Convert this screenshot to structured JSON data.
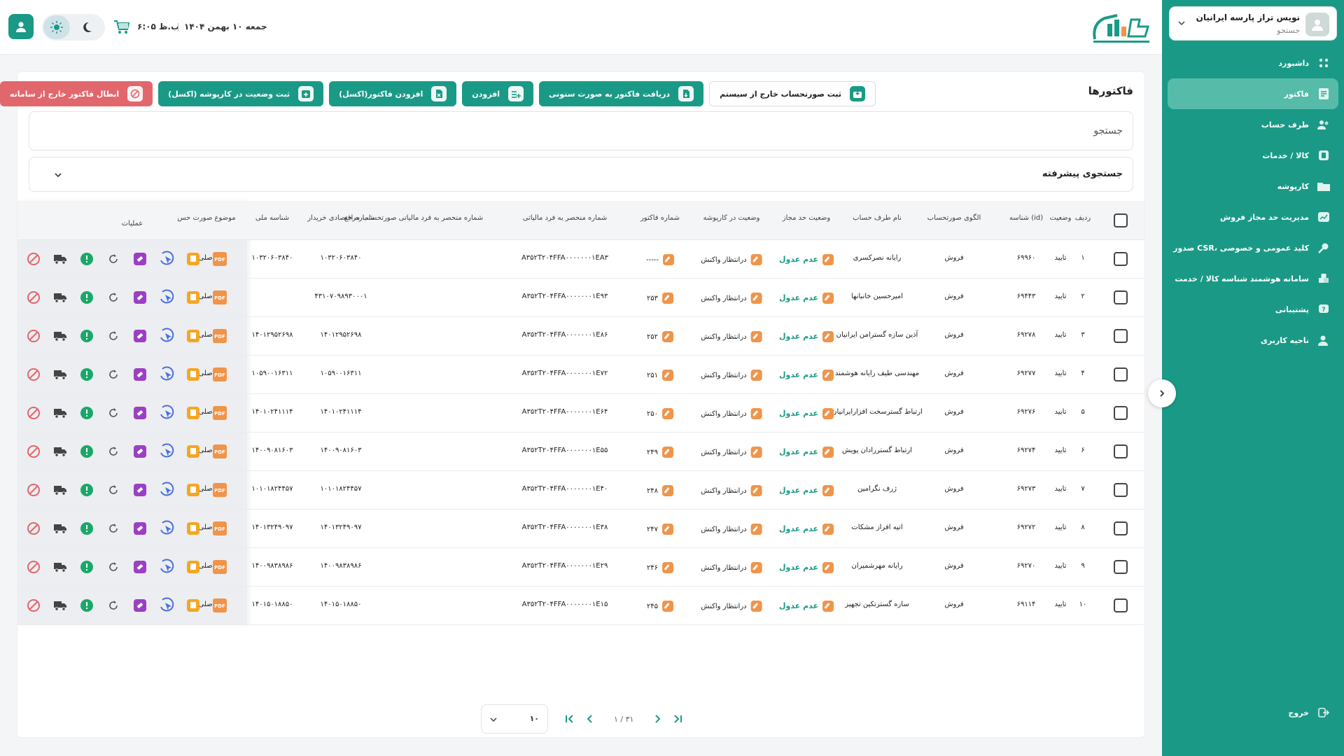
{
  "sidebar": {
    "user_name": "نویس تراز پارسه ایرانیان",
    "user_sub": "جستجو",
    "items": [
      {
        "label": "داشبورد",
        "icon": "dashboard-icon",
        "active": false
      },
      {
        "label": "فاکتور",
        "icon": "invoice-icon",
        "active": true
      },
      {
        "label": "طرف حساب",
        "icon": "users-icon",
        "active": false
      },
      {
        "label": "کالا / خدمات",
        "icon": "product-icon",
        "active": false
      },
      {
        "label": "کارپوشه",
        "icon": "folder-icon",
        "active": false
      },
      {
        "label": "مدیریت حد مجاز فروش",
        "icon": "chart-icon",
        "active": false
      },
      {
        "label": "صدور CSR، کلید عمومی و خصوصی",
        "icon": "key-icon",
        "active": false
      },
      {
        "label": "سامانه هوشمند شناسه کالا / خدمت",
        "icon": "boxes-icon",
        "active": false
      },
      {
        "label": "پشتیبانی",
        "icon": "support-icon",
        "active": false
      },
      {
        "label": "ناحیه کاربری",
        "icon": "user-area-icon",
        "active": false
      }
    ],
    "logout": "خروج"
  },
  "topbar": {
    "time": "۶:۰۵ ب.ظ",
    "date": "جمعه ۱۰ بهمن ۱۴۰۴"
  },
  "page": {
    "title": "فاکتورها",
    "actions": [
      {
        "label": "ثبت صورتحساب خارج از سیستم",
        "style": "outline",
        "icon": "import-icon"
      },
      {
        "label": "دریافت فاکتور به صورت ستونی",
        "style": "teal",
        "icon": "download-file-icon"
      },
      {
        "label": "افزودن",
        "style": "teal",
        "icon": "add-list-icon"
      },
      {
        "label": "افزودن فاکتور(اکسل)",
        "style": "teal",
        "icon": "excel-upload-icon"
      },
      {
        "label": "ثبت وضعیت در کارپوشه (اکسل)",
        "style": "teal",
        "icon": "calendar-plus-icon"
      },
      {
        "label": "ابطال فاکتور خارج از سامانه",
        "style": "red",
        "icon": "cancel-icon"
      }
    ],
    "search_placeholder": "جستجو",
    "advanced_search": "جستجوی پیشرفته"
  },
  "table": {
    "headers": {
      "row": "ردیف",
      "status": "وضعیت",
      "id": "شناسه (id)",
      "pattern": "الگوی صورتحساب",
      "party": "نام طرف حساب",
      "limit": "وضعیت حد مجاز",
      "folder": "وضعیت در کارپوشه",
      "number": "شماره فاکتور",
      "taxid": "شماره منحصر به فرد مالیاتی",
      "ref": "شماره منحصر به فرد مالیاتی صورتحساب مرجع",
      "econ": "شماره اقتصادی خریدار",
      "national": "شناسه ملی",
      "subject": "موضوع صورت حس",
      "ops": "عملیات"
    },
    "rows": [
      {
        "row": "۱",
        "status": "تایید",
        "id": "۶۹۹۶۰",
        "pattern": "فروش",
        "party": "رایانه نصرکسری",
        "limit": "عدم عدول",
        "folder": "درانتظار واکنش",
        "number": "-----",
        "taxid": "A۳۵۲T۲۰۴FFA۰۰۰۰۰۰۰۱EA۳",
        "ref": "",
        "econ": "۱۰۳۲۰۶۰۳۸۴۰",
        "national": "۱۰۳۲۰۶۰۳۸۴۰",
        "subject": "اصلی"
      },
      {
        "row": "۲",
        "status": "تایید",
        "id": "۶۹۴۴۳",
        "pattern": "فروش",
        "party": "امیرحسین خانبانها",
        "limit": "عدم عدول",
        "folder": "درانتظار واکنش",
        "number": "۲۵۳",
        "taxid": "A۳۵۲T۲۰۴FFA۰۰۰۰۰۰۰۱E۹۳",
        "ref": "",
        "econ": "۴۳۱۰۷۰۹۸۹۳۰۰۰۱",
        "national": "",
        "subject": "اصلی"
      },
      {
        "row": "۳",
        "status": "تایید",
        "id": "۶۹۲۷۸",
        "pattern": "فروش",
        "party": "آذین سازه گسترامن ایرانیان",
        "limit": "عدم عدول",
        "folder": "درانتظار واکنش",
        "number": "۲۵۲",
        "taxid": "A۳۵۲T۲۰۴FFA۰۰۰۰۰۰۰۱E۸۶",
        "ref": "",
        "econ": "۱۴۰۱۲۹۵۲۶۹۸",
        "national": "۱۴۰۱۲۹۵۲۶۹۸",
        "subject": "اصلی"
      },
      {
        "row": "۴",
        "status": "تایید",
        "id": "۶۹۲۷۷",
        "pattern": "فروش",
        "party": "مهندسی طیف رایانه هوشمند",
        "limit": "عدم عدول",
        "folder": "درانتظار واکنش",
        "number": "۲۵۱",
        "taxid": "A۳۵۲T۲۰۴FFA۰۰۰۰۰۰۰۱E۷۲",
        "ref": "",
        "econ": "۱۰۵۹۰۰۱۶۳۱۱",
        "national": "۱۰۵۹۰۰۱۶۳۱۱",
        "subject": "اصلی"
      },
      {
        "row": "۵",
        "status": "تایید",
        "id": "۶۹۲۷۶",
        "pattern": "فروش",
        "party": "ارتباط گسترسخت افزارایرانیان",
        "limit": "عدم عدول",
        "folder": "درانتظار واکنش",
        "number": "۲۵۰",
        "taxid": "A۳۵۲T۲۰۴FFA۰۰۰۰۰۰۰۱E۶۴",
        "ref": "",
        "econ": "۱۴۰۱۰۲۴۱۱۱۴",
        "national": "۱۴۰۱۰۲۴۱۱۱۴",
        "subject": "اصلی"
      },
      {
        "row": "۶",
        "status": "تایید",
        "id": "۶۹۲۷۴",
        "pattern": "فروش",
        "party": "ارتباط گستررادان پویش",
        "limit": "عدم عدول",
        "folder": "درانتظار واکنش",
        "number": "۲۴۹",
        "taxid": "A۳۵۲T۲۰۴FFA۰۰۰۰۰۰۰۱E۵۵",
        "ref": "",
        "econ": "۱۴۰۰۹۰۸۱۶۰۳",
        "national": "۱۴۰۰۹۰۸۱۶۰۳",
        "subject": "اصلی"
      },
      {
        "row": "۷",
        "status": "تایید",
        "id": "۶۹۲۷۳",
        "pattern": "فروش",
        "party": "ژرف نگرامین",
        "limit": "عدم عدول",
        "folder": "درانتظار واکنش",
        "number": "۲۴۸",
        "taxid": "A۳۵۲T۲۰۴FFA۰۰۰۰۰۰۰۱E۴۰",
        "ref": "",
        "econ": "۱۰۱۰۱۸۲۴۴۵۷",
        "national": "۱۰۱۰۱۸۲۴۴۵۷",
        "subject": "اصلی"
      },
      {
        "row": "۸",
        "status": "تایید",
        "id": "۶۹۲۷۲",
        "pattern": "فروش",
        "party": "اتیه افراز مشکات",
        "limit": "عدم عدول",
        "folder": "درانتظار واکنش",
        "number": "۲۴۷",
        "taxid": "A۳۵۲T۲۰۴FFA۰۰۰۰۰۰۰۱E۳۸",
        "ref": "",
        "econ": "۱۴۰۱۳۲۴۹۰۹۷",
        "national": "۱۴۰۱۳۲۴۹۰۹۷",
        "subject": "اصلی"
      },
      {
        "row": "۹",
        "status": "تایید",
        "id": "۶۹۲۷۰",
        "pattern": "فروش",
        "party": "رایانه مهرشمیران",
        "limit": "عدم عدول",
        "folder": "درانتظار واکنش",
        "number": "۲۴۶",
        "taxid": "A۳۵۲T۲۰۴FFA۰۰۰۰۰۰۰۱E۲۹",
        "ref": "",
        "econ": "۱۴۰۰۹۸۳۸۹۸۶",
        "national": "۱۴۰۰۹۸۳۸۹۸۶",
        "subject": "اصلی"
      },
      {
        "row": "۱۰",
        "status": "تایید",
        "id": "۶۹۱۱۴",
        "pattern": "فروش",
        "party": "سازه گسترتکین تجهیز",
        "limit": "عدم عدول",
        "folder": "درانتظار واکنش",
        "number": "۲۴۵",
        "taxid": "A۳۵۲T۲۰۴FFA۰۰۰۰۰۰۰۱E۱۵",
        "ref": "",
        "econ": "۱۴۰۱۵۰۱۸۸۵۰",
        "national": "۱۴۰۱۵۰۱۸۸۵۰",
        "subject": "اصلی"
      }
    ],
    "ops": [
      {
        "name": "pdf-icon",
        "color": "#f0944a"
      },
      {
        "name": "receipt-icon",
        "color": "#f5a623"
      },
      {
        "name": "click-icon",
        "color": "#4a6fe0"
      },
      {
        "name": "erase-icon",
        "color": "#9b3fc4"
      },
      {
        "name": "refresh-icon",
        "color": "#555555"
      },
      {
        "name": "alert-icon",
        "color": "#1aa86a"
      },
      {
        "name": "truck-icon",
        "color": "#444444"
      },
      {
        "name": "cancel-icon",
        "color": "#e2676d"
      }
    ]
  },
  "pager": {
    "page_size": "۱۰",
    "info": "۱ / ۳۱"
  },
  "colors": {
    "primary": "#1a9a86",
    "danger": "#e2676d",
    "accent": "#f0944a"
  }
}
